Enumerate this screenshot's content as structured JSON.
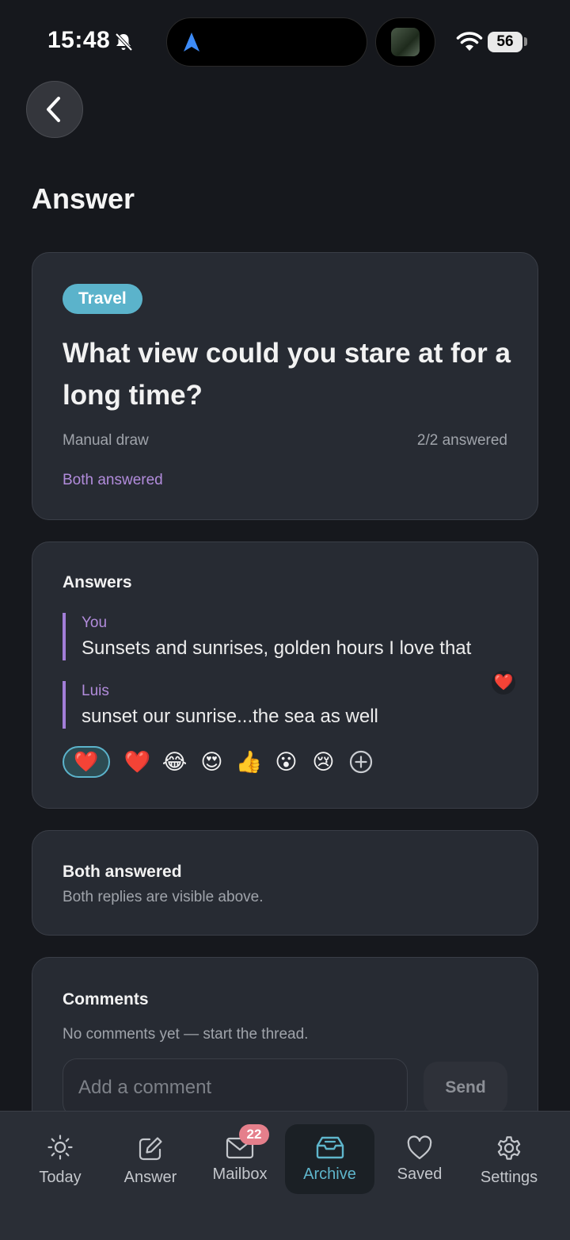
{
  "status_bar": {
    "time": "15:48",
    "battery": "56"
  },
  "header": {
    "title": "Answer"
  },
  "question_card": {
    "tag": "Travel",
    "question": "What view could you stare at for a long time?",
    "draw_mode": "Manual draw",
    "answered_count": "2/2 answered",
    "status": "Both answered"
  },
  "answers_card": {
    "title": "Answers",
    "answers": [
      {
        "name": "You",
        "text": "Sunsets and sunrises, golden hours I love that"
      },
      {
        "name": "Luis",
        "text": "sunset our sunrise...the sea as well",
        "reaction": "❤️"
      }
    ],
    "reactions": [
      "❤️",
      "❤️",
      "😂",
      "😍",
      "👍",
      "😮",
      "😢"
    ]
  },
  "status_card": {
    "title": "Both answered",
    "subtitle": "Both replies are visible above."
  },
  "comments_card": {
    "title": "Comments",
    "empty_text": "No comments yet — start the thread.",
    "input_placeholder": "Add a comment",
    "send_label": "Send"
  },
  "tab_bar": {
    "tabs": [
      {
        "label": "Today",
        "icon": "sun-icon"
      },
      {
        "label": "Answer",
        "icon": "edit-icon"
      },
      {
        "label": "Mailbox",
        "icon": "mail-icon",
        "badge": "22"
      },
      {
        "label": "Archive",
        "icon": "archive-icon",
        "active": true
      },
      {
        "label": "Saved",
        "icon": "heart-icon"
      },
      {
        "label": "Settings",
        "icon": "gear-icon"
      }
    ]
  },
  "colors": {
    "accent_teal": "#5bb3cb",
    "accent_purple": "#b28cdc",
    "badge_pink": "#e57f8b",
    "card_bg": "#272b33",
    "page_bg": "#16181d"
  }
}
